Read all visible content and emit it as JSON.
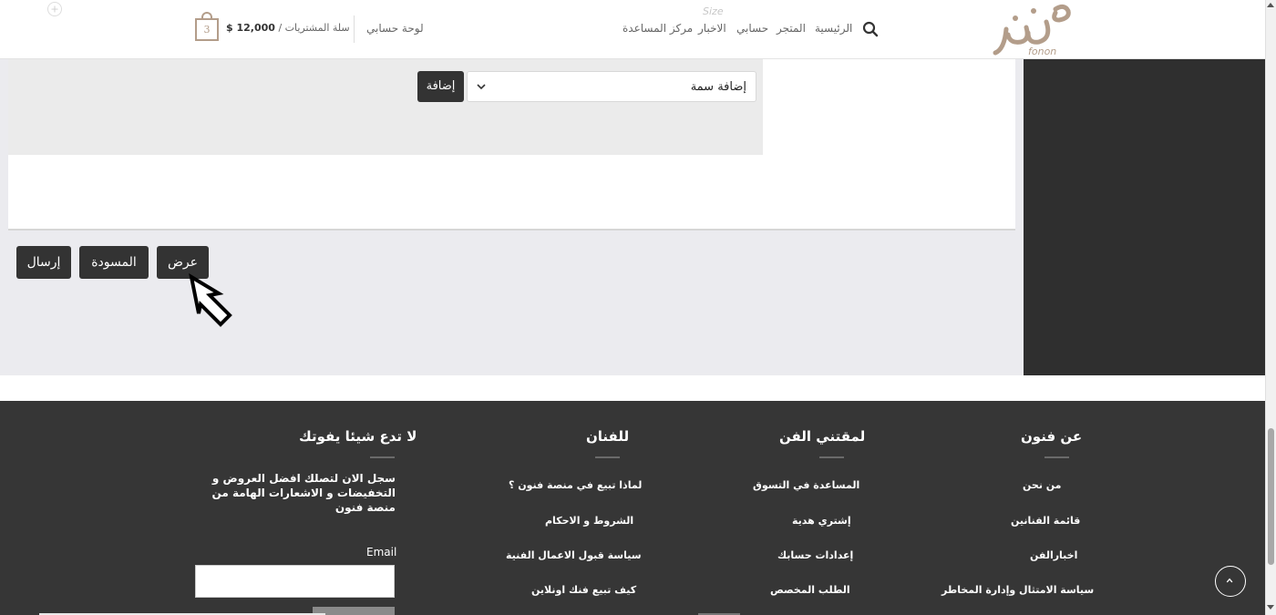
{
  "header": {
    "logo_text": "فنون",
    "logo_sub": "fonon",
    "nav": {
      "home": "الرئيسية",
      "store": "المتجر",
      "account": "حسابي",
      "news": "الاخبار",
      "help": "مركز المساعدة"
    },
    "dashboard": "لوحة حسابي",
    "cart_label": "سلة المشتريات /",
    "cart_total": "12,000 $",
    "cart_count": "3",
    "size_hint": "Size"
  },
  "attributes": {
    "select_value": "إضافة سمة",
    "add_button": "إضافة"
  },
  "actions": {
    "submit": "إرسال",
    "draft": "المسودة",
    "preview": "عرض"
  },
  "footer": {
    "col_about": {
      "title": "عن فنون",
      "links": [
        "من نحن",
        "قائمة الفنانين",
        "اخبارالفن",
        "سياسة الامتثال وإدارة المخاطر"
      ]
    },
    "col_collectors": {
      "title": "لمقتني الفن",
      "links": [
        "المساعدة في التسوق",
        "إشتري هدية",
        "إعدادات حسابك",
        "الطلب المخصص"
      ]
    },
    "col_artists": {
      "title": "للفنان",
      "links": [
        "لماذا تبيع في منصة فنون ؟",
        "الشروط و الاحكام",
        "سياسة قبول الاعمال الفنية",
        "كيف تبيع فنك اونلاين"
      ]
    },
    "col_newsletter": {
      "title": "لا تدع شيئا يفوتك",
      "text": "سجل الان  لتصلك افضل  العروض و التخفيضات و الاشعارات الهامة من منصة فنون",
      "email_label": "Email"
    }
  },
  "colors": {
    "accent": "#b39d8a",
    "dark": "#333333",
    "footer_bg": "#363636"
  }
}
